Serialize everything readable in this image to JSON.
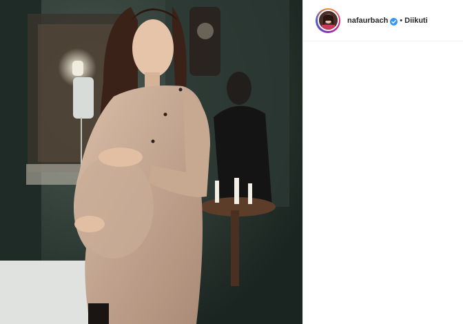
{
  "post": {
    "image": {
      "alt_subject": "pregnant-woman-photo"
    },
    "header": {
      "username": "nafaurbach",
      "separator": "•",
      "follow_status": "Diikuti",
      "verified_icon": "verified-badge-icon",
      "verified_color": "#3897f0"
    }
  }
}
